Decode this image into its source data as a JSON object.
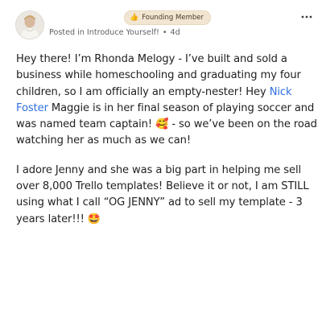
{
  "post": {
    "badge_emoji": "👍",
    "badge_label": "Founding Member",
    "posted_in": "Posted in Introduce Yourself!",
    "separator": "•",
    "time_ago": "4d",
    "para1_before_mention": "Hey there! I’m Rhonda Melogy - I’ve built and sold a business while homeschooling and graduating my four children, so I am officially an empty-nester! Hey ",
    "mention": "Nick Foster",
    "para1_after_mention": " Maggie is in her final season of playing soccer and was named team captain! 🥰 - so we’ve been on the road watching her as much as we can!",
    "para2": "I adore Jenny and she was a big part in helping me sell over 8,000 Trello templates!  Believe it or not, I am STILL using what I call “OG JENNY” ad to sell my template - 3 years later!!! 🤩"
  },
  "icons": {
    "avatar": "avatar-photo",
    "more": "ellipsis-horizontal-icon"
  },
  "colors": {
    "mention": "#2f6fe0",
    "badge_bg": "#f2e6d3",
    "meta_text": "#5f6368"
  }
}
